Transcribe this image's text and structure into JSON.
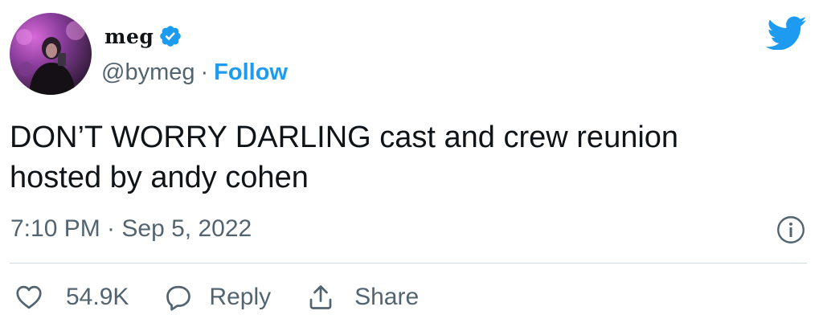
{
  "author": {
    "display_name": "meg",
    "handle": "@bymeg",
    "verified": true,
    "follow_label": "Follow",
    "separator": "·"
  },
  "tweet": {
    "text_lines": [
      "DON’T WORRY DARLING cast and crew reunion",
      "hosted by andy cohen"
    ],
    "timestamp": "7:10 PM · Sep 5, 2022"
  },
  "actions": {
    "likes_count": "54.9K",
    "reply_label": "Reply",
    "share_label": "Share"
  },
  "icons": {
    "brand": "twitter-bird-icon",
    "verified": "verified-badge-icon",
    "info": "info-icon",
    "like": "heart-icon",
    "reply": "speech-bubble-icon",
    "share": "share-arrow-icon"
  },
  "colors": {
    "accent": "#1d9bf0",
    "text_primary": "#0f1419",
    "text_secondary": "#536471",
    "divider": "#cfd9de"
  }
}
